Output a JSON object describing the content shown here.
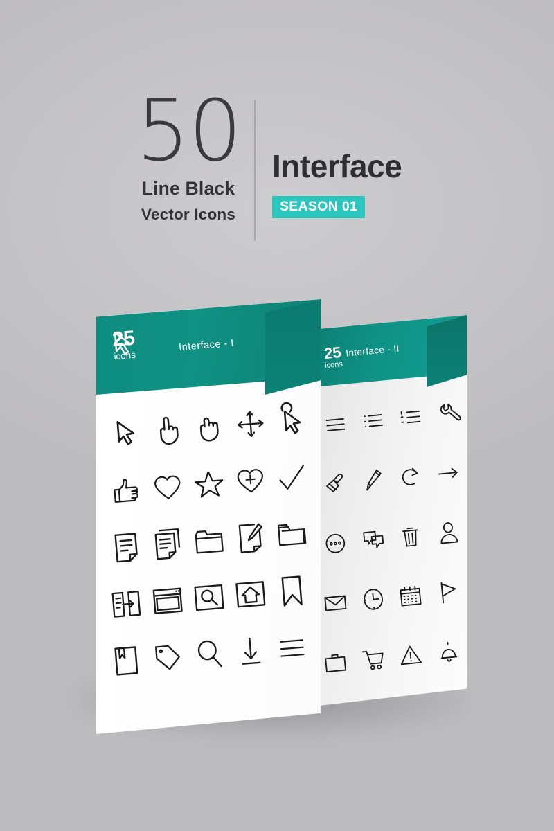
{
  "header": {
    "count": "50",
    "subtitle_line1": "Line Black",
    "subtitle_line2": "Vector Icons",
    "title": "Interface",
    "badge": "SEASON 01"
  },
  "theme": {
    "background": "#c6c5c7",
    "teal_header": "#0f9183",
    "teal_badge_dark": "#0b7a6f",
    "accent_badge": "#2bc7bf",
    "icon_stroke": "#1b1b1b",
    "text_dark": "#2f2f31",
    "panel_white": "#ffffff"
  },
  "panels": [
    {
      "id": "front",
      "header_label": "Interface - I",
      "header_icon": "cursor-arrow-icon",
      "count": "25",
      "count_label": "icons",
      "rows": [
        [
          "cursor-arrow-icon",
          "hand-pointer-icon",
          "hand-grab-icon",
          "move-arrows-icon",
          "cursor-loading-icon"
        ],
        [
          "thumbs-up-icon",
          "heart-icon",
          "star-icon",
          "heart-plus-icon",
          "check-icon"
        ],
        [
          "document-icon",
          "documents-copy-icon",
          "folder-icon",
          "document-edit-icon",
          "folder-open-icon"
        ],
        [
          "file-transfer-icon",
          "browser-window-icon",
          "search-page-icon",
          "home-page-icon",
          "bookmark-icon"
        ],
        [
          "bookmarked-page-icon",
          "tag-icon",
          "magnifier-icon",
          "download-icon",
          "menu-lines-icon"
        ]
      ]
    },
    {
      "id": "back",
      "header_label": "Interface - II",
      "count": "25",
      "count_label": "icons",
      "rows": [
        [
          "list-lines-icon",
          "bullet-list-icon",
          "numbered-list-icon",
          "wrench-icon"
        ],
        [
          "paint-brush-icon",
          "pencil-icon",
          "undo-arrow-icon",
          "arrow-right-icon"
        ],
        [
          "more-options-icon",
          "chat-bubbles-icon",
          "trash-icon",
          "user-icon"
        ],
        [
          "envelope-icon",
          "clock-icon",
          "calendar-icon",
          "flag-icon"
        ],
        [
          "briefcase-icon",
          "shopping-cart-icon",
          "warning-triangle-icon",
          "bell-icon"
        ]
      ]
    }
  ]
}
